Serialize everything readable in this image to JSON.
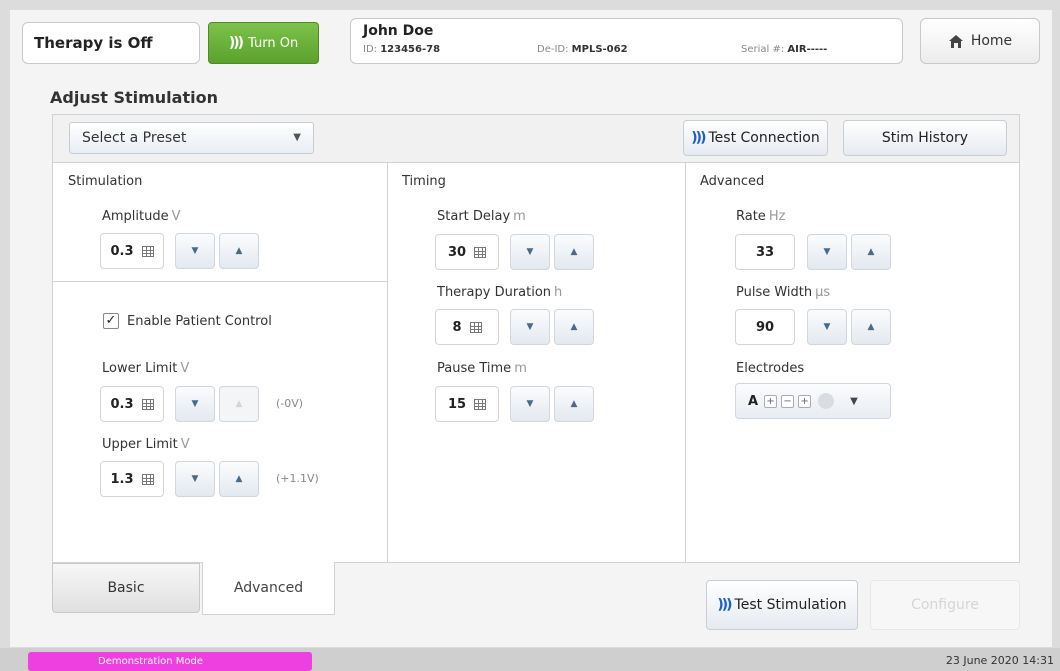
{
  "header": {
    "therapy_status": "Therapy is Off",
    "turn_on_label": "Turn On",
    "patient": {
      "name": "John Doe",
      "id_label": "ID:",
      "id_value": "123456-78",
      "deid_label": "De-ID:",
      "deid_value": "MPLS-062",
      "serial_label": "Serial #:",
      "serial_value": "AIR-----"
    },
    "home_label": "Home"
  },
  "page_title": "Adjust Stimulation",
  "toolbar": {
    "preset_placeholder": "Select a Preset",
    "test_connection_label": "Test Connection",
    "stim_history_label": "Stim History"
  },
  "stimulation": {
    "title": "Stimulation",
    "amplitude": {
      "label": "Amplitude",
      "unit": "V",
      "value": "0.3"
    },
    "enable_patient_control": {
      "label": "Enable Patient Control",
      "checked": true
    },
    "lower_limit": {
      "label": "Lower Limit",
      "unit": "V",
      "value": "0.3",
      "hint": "(-0V)"
    },
    "upper_limit": {
      "label": "Upper Limit",
      "unit": "V",
      "value": "1.3",
      "hint": "(+1.1V)"
    }
  },
  "timing": {
    "title": "Timing",
    "start_delay": {
      "label": "Start Delay",
      "unit": "m",
      "value": "30"
    },
    "therapy_duration": {
      "label": "Therapy Duration",
      "unit": "h",
      "value": "8"
    },
    "pause_time": {
      "label": "Pause Time",
      "unit": "m",
      "value": "15"
    }
  },
  "advanced": {
    "title": "Advanced",
    "rate": {
      "label": "Rate",
      "unit": "Hz",
      "value": "33"
    },
    "pulse_width": {
      "label": "Pulse Width",
      "unit": "µs",
      "value": "90"
    },
    "electrodes": {
      "label": "Electrodes",
      "value": "A",
      "marks": [
        "+",
        "−",
        "+"
      ]
    }
  },
  "tabs": {
    "basic": "Basic",
    "advanced": "Advanced"
  },
  "actions": {
    "test_stimulation_label": "Test Stimulation",
    "configure_label": "Configure"
  },
  "status_bar": {
    "mode": "Demonstration Mode",
    "datetime": "23 June 2020 14:31"
  },
  "colors": {
    "turn_on": "#5aa22c",
    "demo_mode": "#ee40e0",
    "signal_icon": "#1a5fd0"
  }
}
